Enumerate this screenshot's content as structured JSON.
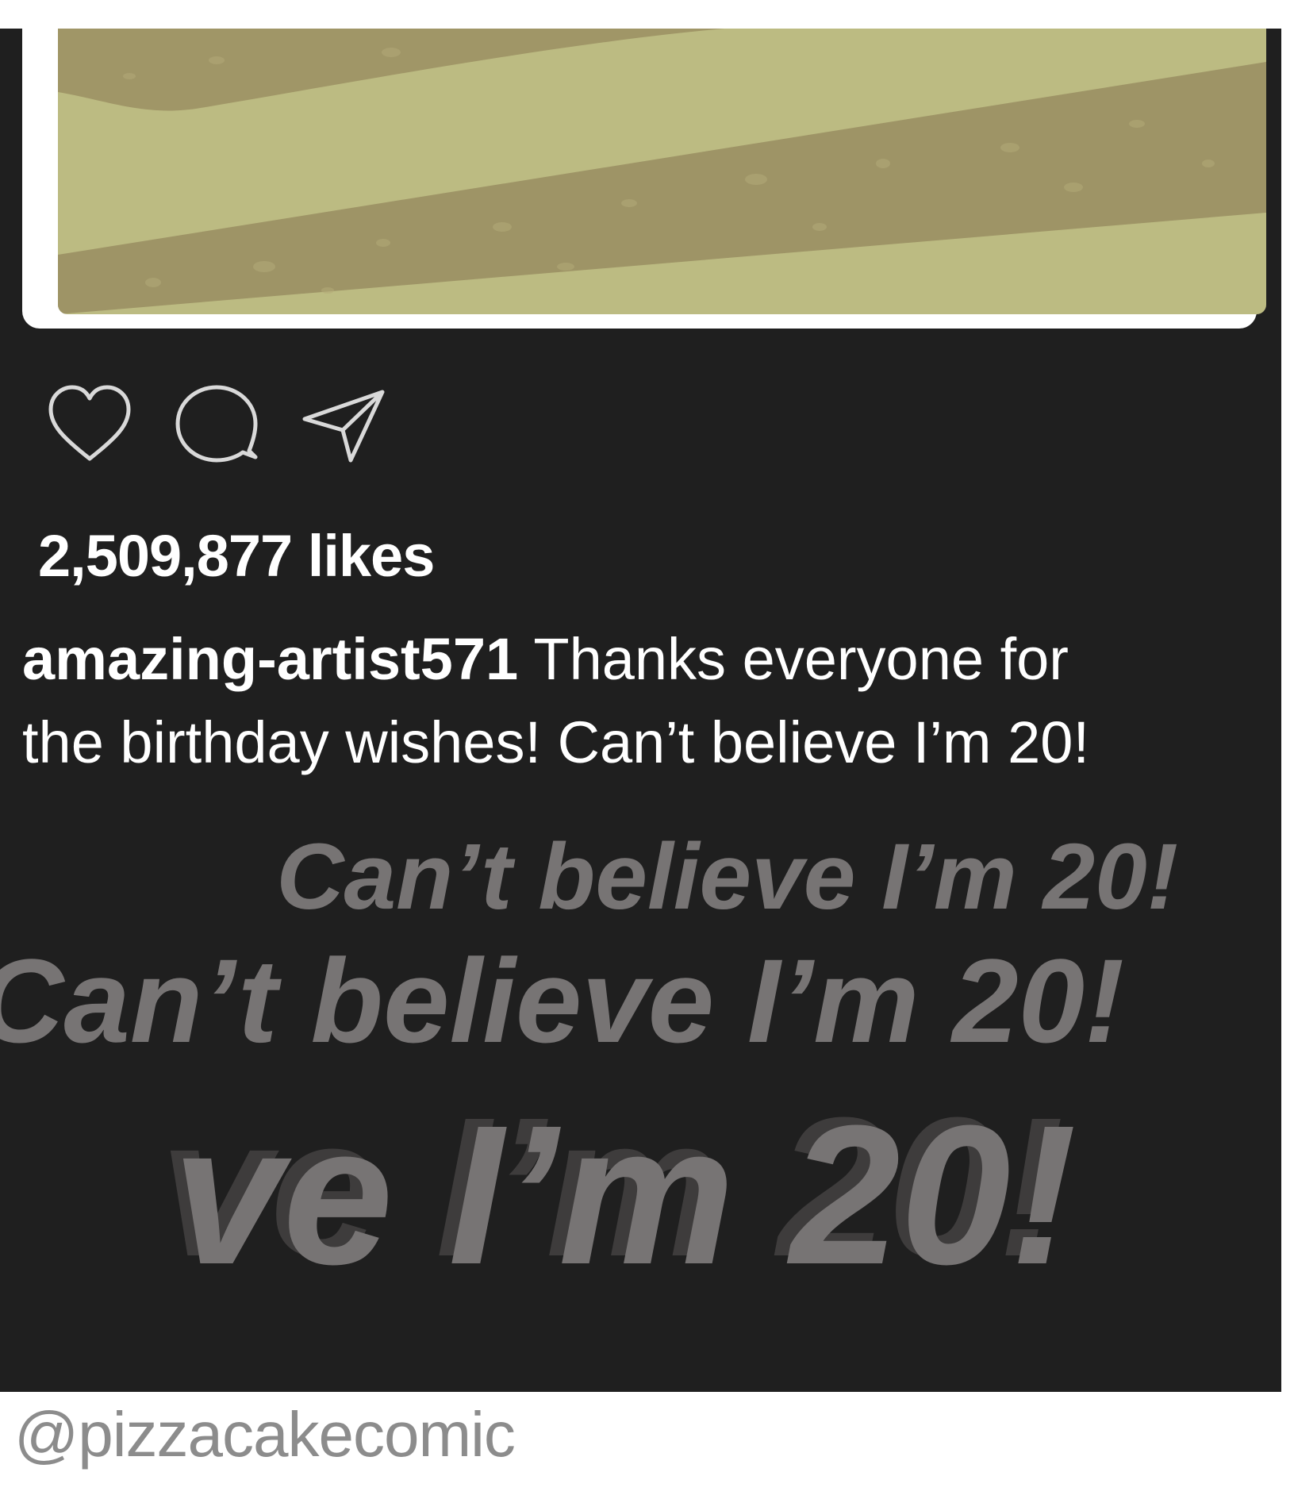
{
  "post": {
    "likes_text": "2,509,877 likes",
    "username": "amazing-artist571",
    "caption_line1": " Thanks everyone for",
    "caption_line2": "the birthday wishes! Can’t believe I’m 20!",
    "actions": [
      {
        "icon": "heart-icon"
      },
      {
        "icon": "comment-icon"
      },
      {
        "icon": "share-icon"
      }
    ]
  },
  "echo": {
    "line1": "Can’t believe I’m 20!",
    "line2": "Can’t believe I’m 20!",
    "line3": "ve I’m 20!"
  },
  "watermark": "@pizzacakecomic",
  "colors": {
    "panel": "#1f1f1f",
    "photo_light": "#bcbb82",
    "photo_dark": "#9e9466",
    "echo_text": "#777474",
    "watermark": "#8c8c8c"
  }
}
